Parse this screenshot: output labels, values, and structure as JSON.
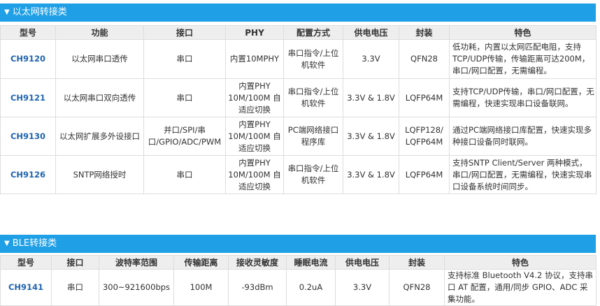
{
  "section1": {
    "title": "以太网转接类",
    "headers": [
      "型号",
      "功能",
      "接口",
      "PHY",
      "配置方式",
      "供电电压",
      "封装",
      "特色"
    ],
    "rows": [
      {
        "model": "CH9120",
        "function": "以太网串口透传",
        "interface": "串口",
        "phy": "内置10MPHY",
        "config": "串口指令/上位机软件",
        "voltage": "3.3V",
        "package": "QFN28",
        "feature": "低功耗，内置以太网匹配电阻，支持TCP/UDP传输，传输距离可达200M，串口/网口配置，无需编程。"
      },
      {
        "model": "CH9121",
        "function": "以太网串口双向透传",
        "interface": "串口",
        "phy": "内置PHY 10M/100M 自适应切换",
        "config": "串口指令/上位机软件",
        "voltage": "3.3V & 1.8V",
        "package": "LQFP64M",
        "feature": "支持TCP/UDP传输，串口/网口配置，无需编程，快速实现串口设备联网。"
      },
      {
        "model": "CH9130",
        "function": "以太网扩展多外设接口",
        "interface": "并口/SPI/串口/GPIO/ADC/PWM",
        "phy": "内置PHY 10M/100M 自适应切换",
        "config": "PC端网络接口程序库",
        "voltage": "3.3V & 1.8V",
        "package": "LQFP128/ LQFP64M",
        "feature": "通过PC端网络接口库配置，快速实现多种接口设备同时联网。"
      },
      {
        "model": "CH9126",
        "function": "SNTP网络授时",
        "interface": "串口",
        "phy": "内置PHY 10M/100M 自适应切换",
        "config": "串口指令/上位机软件",
        "voltage": "3.3V & 1.8V",
        "package": "LQFP64M",
        "feature": "支持SNTP Client/Server 两种模式，串口/网口配置，无需编程，快速实现串口设备系统时间同步。"
      }
    ]
  },
  "section2": {
    "title": "BLE转接类",
    "headers": [
      "型号",
      "接口",
      "波特率范围",
      "传输距离",
      "接收灵敏度",
      "睡眠电流",
      "供电电压",
      "封装",
      "特色"
    ],
    "rows": [
      {
        "model": "CH9141",
        "interface": "串口",
        "baud": "300~921600bps",
        "distance": "100M",
        "sensitivity": "-93dBm",
        "sleep": "0.2uA",
        "voltage": "3.3V",
        "package": "QFN28",
        "feature": "支持标准 Bluetooth V4.2 协议，支持串口 AT 配置，通用/同步 GPIO、ADC 采集功能。"
      }
    ]
  },
  "colors": {
    "header_bg": "#1e9fe6",
    "model_text": "#1f64b0",
    "th_bg": "#eeeeee",
    "border": "#dddddd"
  },
  "icons": {
    "collapse": "triangle-down-icon"
  }
}
